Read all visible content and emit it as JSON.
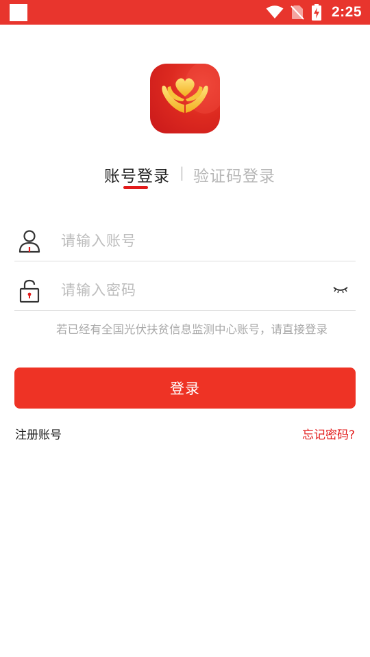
{
  "status_bar": {
    "time": "2:25",
    "icons": [
      "app-notification-icon",
      "wifi-icon",
      "no-sim-icon",
      "battery-charging-icon"
    ]
  },
  "tabs": {
    "account_login": "账号登录",
    "divider": "|",
    "sms_login": "验证码登录"
  },
  "form": {
    "account_placeholder": "请输入账号",
    "password_placeholder": "请输入密码",
    "account_icon": "user-icon",
    "password_icon": "lock-icon",
    "eye_icon": "eye-closed-icon"
  },
  "hint": "若已经有全国光伏扶贫信息监测中心账号，请直接登录",
  "login_button": "登录",
  "links": {
    "register": "注册账号",
    "forgot_password": "忘记密码?"
  },
  "colors": {
    "primary": "#ee3325",
    "status_bar": "#e8352d",
    "accent_text": "#e21b1b"
  }
}
